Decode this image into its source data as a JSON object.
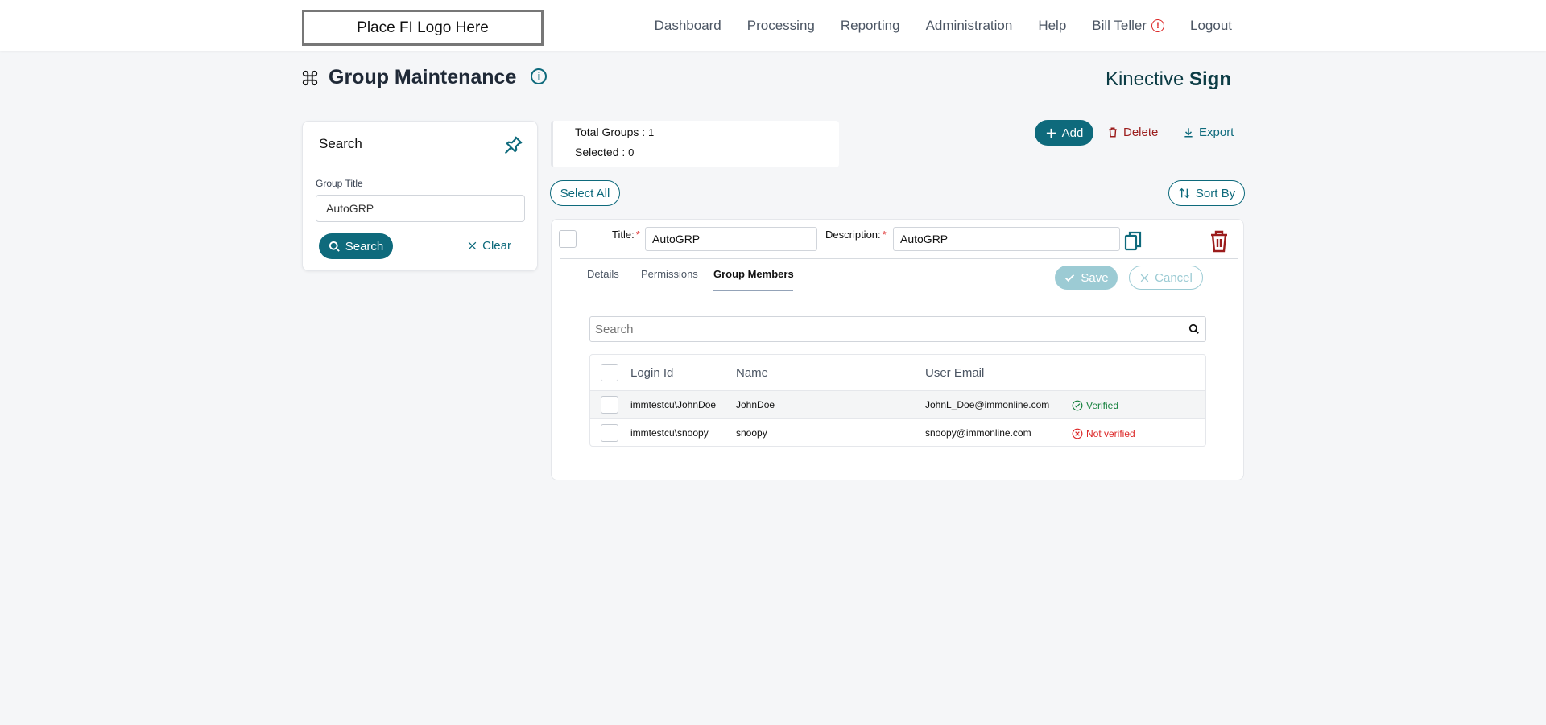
{
  "header": {
    "logo_text": "Place FI Logo Here",
    "nav": [
      "Dashboard",
      "Processing",
      "Reporting",
      "Administration",
      "Help"
    ],
    "user_name": "Bill Teller",
    "logout_label": "Logout"
  },
  "page": {
    "title": "Group Maintenance",
    "brand_light": "Kinective ",
    "brand_bold": "Sign"
  },
  "search_panel": {
    "title": "Search",
    "field_label": "Group Title",
    "field_value": "AutoGRP",
    "search_label": "Search",
    "clear_label": "Clear"
  },
  "summary": {
    "total_label": "Total Groups : ",
    "total_value": "1",
    "selected_label": "Selected : ",
    "selected_value": "0"
  },
  "toolbar": {
    "add_label": "Add",
    "delete_label": "Delete",
    "export_label": "Export",
    "select_all_label": "Select All",
    "sort_by_label": "Sort By"
  },
  "group_card": {
    "title_label": "Title:",
    "title_value": "AutoGRP",
    "description_label": "Description:",
    "description_value": "AutoGRP",
    "required_mark": "*",
    "tabs": [
      "Details",
      "Permissions",
      "Group Members"
    ],
    "active_tab": "Group Members",
    "save_label": "Save",
    "cancel_label": "Cancel",
    "member_search_placeholder": "Search",
    "columns": [
      "Login Id",
      "Name",
      "User Email"
    ],
    "rows": [
      {
        "login_id": "immtestcu\\JohnDoe",
        "name": "JohnDoe",
        "email": "JohnL_Doe@immonline.com",
        "status": "Verified"
      },
      {
        "login_id": "immtestcu\\snoopy",
        "name": "snoopy",
        "email": "snoopy@immonline.com",
        "status": "Not verified"
      }
    ]
  },
  "colors": {
    "accent": "#0e6a7c",
    "danger": "#9b1c1c",
    "verified": "#15803d",
    "not_verified": "#dc2626"
  }
}
